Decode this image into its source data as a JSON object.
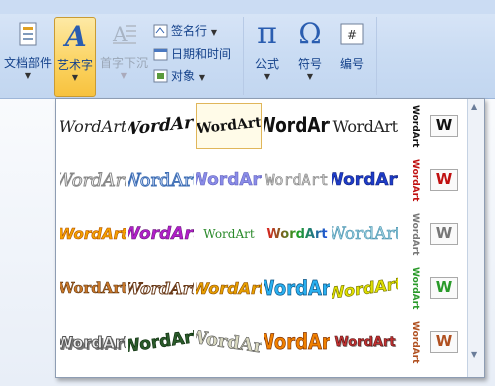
{
  "ribbon": {
    "doc_parts": "文档部件",
    "wordart": "艺术字",
    "dropcap": "首字下沉",
    "signature": "签名行",
    "datetime": "日期和时间",
    "object": "对象",
    "equation": "公式",
    "symbol": "符号",
    "number": "编号"
  },
  "gallery": {
    "label": "WordArt",
    "styles": [
      [
        "WordArt",
        "WordArt",
        "WordArt",
        "WordArt",
        "WordArt"
      ],
      [
        "WordArt",
        "WordArt",
        "WordArt",
        "WordArt",
        "WordArt"
      ],
      [
        "WordArt",
        "WordArt",
        "WordArt",
        "WordArt",
        "WordArt"
      ],
      [
        "WordArt",
        "WordArt",
        "WordArt",
        "WordArt",
        "WordArt"
      ],
      [
        "WordArt",
        "WordArt",
        "WordArt",
        "WordArt",
        "WordArt"
      ]
    ],
    "selected": [
      0,
      2
    ],
    "vertical_label": "WordArt",
    "icon_letter": "W"
  },
  "colors": {
    "ribbon_text": "#15428b",
    "selected_button": "#fbd25e"
  }
}
